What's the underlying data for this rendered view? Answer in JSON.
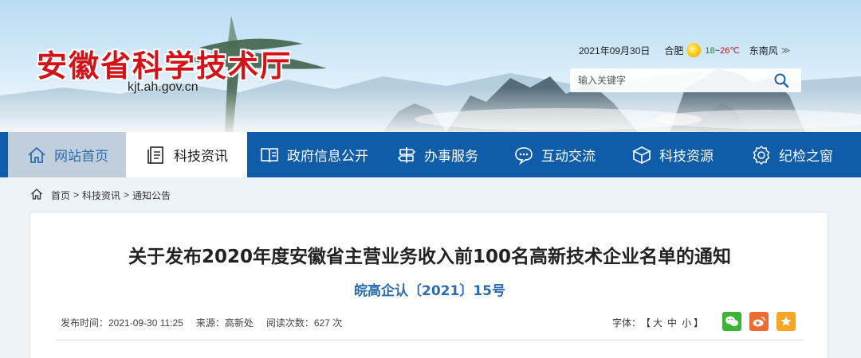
{
  "header": {
    "site_title": "安徽省科学技术厅",
    "site_domain": "kjt.ah.gov.cn",
    "date": "2021年09月30日",
    "city": "合肥",
    "weather_icon": "sun-icon",
    "temp_low": "18",
    "temp_sep": "~",
    "temp_high": "26℃",
    "wind": "东南风",
    "wind_more": "≫",
    "search_placeholder": "输入关键字"
  },
  "nav": {
    "items": [
      {
        "label": "网站首页",
        "icon": "house-icon"
      },
      {
        "label": "科技资讯",
        "icon": "document-icon"
      },
      {
        "label": "政府信息公开",
        "icon": "book-icon"
      },
      {
        "label": "办事服务",
        "icon": "signpost-icon"
      },
      {
        "label": "互动交流",
        "icon": "chat-icon"
      },
      {
        "label": "科技资源",
        "icon": "cube-icon"
      },
      {
        "label": "纪检之窗",
        "icon": "badge-icon"
      }
    ],
    "active_index": 1
  },
  "breadcrumb": {
    "items": [
      "首页",
      "科技资讯",
      "通知公告"
    ],
    "separator": ">"
  },
  "article": {
    "title": "关于发布2020年度安徽省主营业务收入前100名高新技术企业名单的通知",
    "doc_number": "皖高企认〔2021〕15号",
    "publish_time": "发布时间：2021-09-30 11:25",
    "source": "来源：高新处",
    "views": "阅读次数：627 次",
    "font_label": "字体：",
    "font_open": "【",
    "font_large": "大",
    "font_medium": "中",
    "font_small": "小",
    "font_close": "】",
    "share_icons": [
      "wechat-icon",
      "weibo-icon",
      "star-icon"
    ]
  },
  "colors": {
    "nav_bg": "#0f5ca8",
    "title_red": "#d0141a",
    "doc_blue": "#2b6cb0"
  }
}
